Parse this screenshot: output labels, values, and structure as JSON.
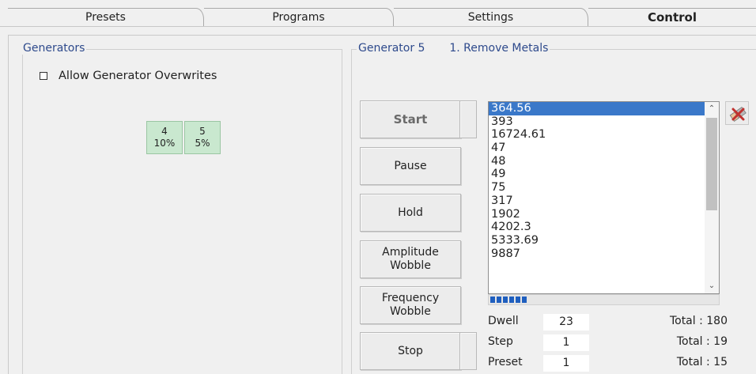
{
  "tabs": [
    {
      "label": "Presets",
      "active": false
    },
    {
      "label": "Programs",
      "active": false
    },
    {
      "label": "Settings",
      "active": false
    },
    {
      "label": "Control",
      "active": true
    }
  ],
  "generators_group": {
    "title": "Generators",
    "allow_overwrite_label": "Allow Generator Overwrites",
    "allow_overwrite_checked": false,
    "chips": [
      {
        "id": "4",
        "percent": "10%"
      },
      {
        "id": "5",
        "percent": "5%"
      }
    ]
  },
  "generator_panel": {
    "title": "Generator 5",
    "program": "1. Remove Metals"
  },
  "buttons": {
    "start": "Start",
    "pause": "Pause",
    "hold": "Hold",
    "amplitude_wobble_line1": "Amplitude",
    "amplitude_wobble_line2": "Wobble",
    "frequency_wobble_line1": "Frequency",
    "frequency_wobble_line2": "Wobble",
    "stop": "Stop"
  },
  "frequency_list": [
    "364.56",
    "393",
    "16724.61",
    "47",
    "48",
    "49",
    "75",
    "317",
    "1902",
    "4202.3",
    "5333.69",
    "9887"
  ],
  "selected_index": 0,
  "progress": 0.16,
  "stats": {
    "dwell_label": "Dwell",
    "dwell_value": "23",
    "dwell_total": "Total : 180",
    "step_label": "Step",
    "step_value": "1",
    "step_total": "Total : 19",
    "preset_label": "Preset",
    "preset_value": "1",
    "preset_total": "Total : 15"
  },
  "colors": {
    "accent": "#2e4a8c",
    "selection": "#3a78c9",
    "chip": "#c9e8cf",
    "progress": "#1f5fbf"
  },
  "icons": {
    "clear_list": "eraser-icon"
  }
}
